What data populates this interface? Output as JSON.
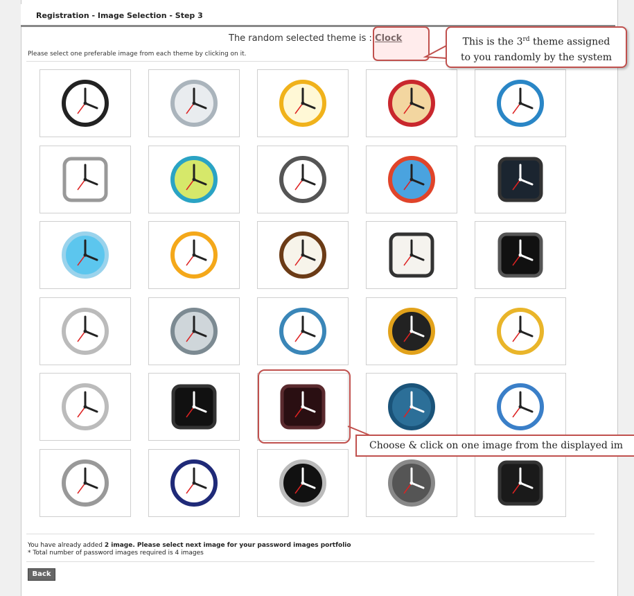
{
  "header": {
    "title": "Registration - Image Selection - Step 3"
  },
  "theme": {
    "prefix": "The random selected theme is : ",
    "name": "Clock"
  },
  "instruction": "Please select one preferable image from each theme by clicking on it.",
  "annotations": {
    "theme_note_line1a": "This is the 3",
    "theme_note_sup": "rd",
    "theme_note_line1b": " theme assigned",
    "theme_note_line2": "to you randomly by the system",
    "click_note": "Choose & click on one image from the displayed im"
  },
  "grid": {
    "rows": 6,
    "cols": 5,
    "images": [
      "clock-black-chrome",
      "clock-silver-round",
      "clock-yellow-alarm",
      "clock-red-beige",
      "clock-blue-alarm",
      "clock-square-silver",
      "clock-green-alarm",
      "clock-sketch-alarm",
      "clock-blue-face-alarm",
      "clock-dark-square",
      "clock-blue-disc",
      "clock-orange-round",
      "clock-pocket-watch",
      "clock-white-square",
      "clock-black-ios",
      "clock-white-alarm",
      "clock-octagon",
      "clock-blue-desk",
      "clock-black-alarm",
      "clock-gold-small",
      "clock-bell-alarm",
      "clock-flip-digital",
      "clock-dark-red-square",
      "clock-blue-globe",
      "clock-numbers-blue",
      "clock-stopwatch",
      "clock-navy-ring",
      "clock-black-round",
      "clock-grey-dome",
      "clock-wrist-watch"
    ],
    "selected_index": 22
  },
  "status": {
    "line1_prefix": "You have already added ",
    "line1_bold": "2 image. Please select next image for your password images portfolio",
    "line2": "* Total number of password images required is 4 images"
  },
  "buttons": {
    "back": "Back"
  }
}
